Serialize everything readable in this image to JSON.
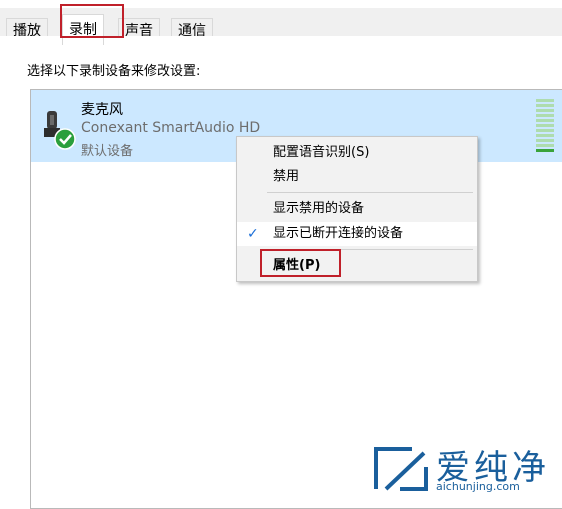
{
  "tabs": [
    {
      "label": "播放"
    },
    {
      "label": "录制"
    },
    {
      "label": "声音"
    },
    {
      "label": "通信"
    }
  ],
  "instruction": "选择以下录制设备来修改设置:",
  "device": {
    "name": "麦克风",
    "description": "Conexant SmartAudio HD",
    "status": "默认设备",
    "icon": "microphone-icon",
    "status_icon": "check-circle-icon",
    "status_color": "#2b9f3c"
  },
  "context_menu": {
    "items": [
      {
        "label": "配置语音识别(S)"
      },
      {
        "label": "禁用"
      },
      {
        "label": "显示禁用的设备"
      },
      {
        "label": "显示已断开连接的设备",
        "checked": true
      },
      {
        "label": "属性(P)",
        "bold": true
      }
    ]
  },
  "highlight_color": "#c0202a",
  "watermark": {
    "text": "爱纯净",
    "url": "aichunjing.com"
  }
}
